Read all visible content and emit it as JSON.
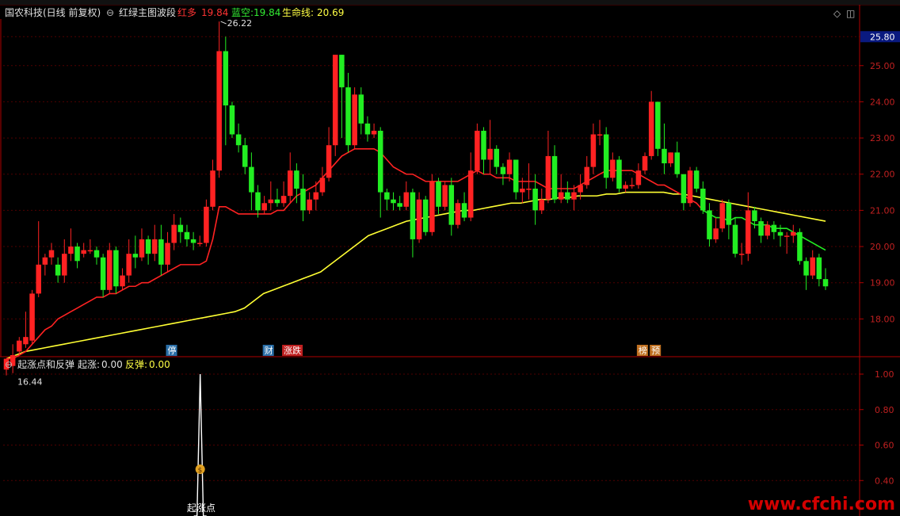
{
  "header": {
    "stock_name": "国农科技(日线 前复权)",
    "indicator_name": "红绿主图波段",
    "red_label": "红多",
    "red_value": "19.84",
    "blue_label": "蓝空:",
    "blue_value": "19.84",
    "life_label": "生命线:",
    "life_value": "20.69"
  },
  "sub_header": {
    "indicator_name": "起涨点和反弹",
    "rise_label": "起涨:",
    "rise_value": "0.00",
    "rebound_label": "反弹:",
    "rebound_value": "0.00"
  },
  "price_axis": {
    "current_price": "25.80",
    "ticks": [
      18,
      19,
      20,
      21,
      22,
      23,
      24,
      25
    ],
    "range": [
      17.0,
      26.2
    ]
  },
  "sub_axis": {
    "ticks": [
      "1.00",
      "0.80",
      "0.60",
      "0.40"
    ],
    "range": [
      0.2,
      1.0
    ]
  },
  "annotations": {
    "high_label": "26.22",
    "low_label": "16.44",
    "rise_point_label": "起涨点",
    "markers": [
      {
        "text": "停",
        "color": "#2a6fa8",
        "index": 25
      },
      {
        "text": "财",
        "color": "#2a6fa8",
        "index": 40
      },
      {
        "text": "涨跌",
        "color": "#c02020",
        "index": 43
      },
      {
        "text": "榜",
        "color": "#c07020",
        "index": 98
      },
      {
        "text": "预",
        "color": "#c07020",
        "index": 100
      }
    ]
  },
  "colors": {
    "up": "#ff2222",
    "down": "#22ee22",
    "red_line": "#ff2222",
    "green_line": "#22ee22",
    "life_line": "#ffff33",
    "axis": "#b00000",
    "grid": "#500000"
  },
  "chart_data": {
    "type": "candlestick",
    "candles": [
      [
        16.6,
        16.9,
        16.44,
        16.7
      ],
      [
        16.7,
        17.0,
        16.5,
        17.3
      ],
      [
        17.1,
        17.4,
        17.0,
        17.5
      ],
      [
        17.3,
        17.5,
        17.2,
        18.2
      ],
      [
        17.4,
        18.7,
        17.3,
        18.8
      ],
      [
        18.7,
        19.5,
        18.6,
        20.7
      ],
      [
        19.5,
        19.7,
        19.2,
        19.8
      ],
      [
        19.7,
        19.9,
        19.5,
        20.1
      ],
      [
        19.5,
        19.2,
        19.0,
        19.7
      ],
      [
        19.2,
        19.8,
        19.0,
        20.2
      ],
      [
        19.8,
        20.0,
        19.6,
        20.5
      ],
      [
        20.0,
        19.6,
        19.4,
        20.1
      ],
      [
        19.8,
        19.9,
        19.7,
        20.1
      ],
      [
        19.9,
        19.9,
        19.8,
        20.2
      ],
      [
        19.9,
        19.7,
        19.5,
        20.0
      ],
      [
        19.7,
        18.8,
        18.6,
        19.8
      ],
      [
        18.8,
        19.9,
        18.7,
        20.1
      ],
      [
        19.9,
        18.9,
        18.7,
        20.0
      ],
      [
        18.9,
        19.2,
        18.8,
        19.4
      ],
      [
        19.2,
        19.8,
        19.0,
        20.2
      ],
      [
        19.8,
        19.7,
        19.4,
        20.3
      ],
      [
        19.7,
        20.2,
        19.6,
        20.5
      ],
      [
        20.2,
        19.8,
        19.5,
        20.3
      ],
      [
        19.8,
        20.2,
        19.6,
        20.6
      ],
      [
        20.2,
        19.5,
        19.2,
        20.6
      ],
      [
        19.5,
        20.1,
        19.3,
        20.4
      ],
      [
        20.1,
        20.6,
        19.9,
        20.9
      ],
      [
        20.6,
        20.4,
        20.1,
        20.8
      ],
      [
        20.4,
        20.2,
        20.0,
        20.6
      ],
      [
        20.2,
        20.1,
        19.9,
        20.4
      ],
      [
        20.1,
        20.1,
        20.0,
        20.3
      ],
      [
        20.1,
        21.1,
        20.0,
        21.3
      ],
      [
        21.1,
        22.1,
        21.0,
        22.4
      ],
      [
        22.1,
        25.4,
        21.9,
        26.22
      ],
      [
        25.4,
        23.9,
        22.8,
        25.8
      ],
      [
        23.9,
        23.1,
        23.0,
        24.0
      ],
      [
        23.1,
        22.8,
        22.6,
        23.4
      ],
      [
        22.8,
        22.2,
        22.0,
        23.0
      ],
      [
        22.2,
        21.5,
        21.0,
        22.6
      ],
      [
        21.5,
        21.0,
        20.8,
        21.7
      ],
      [
        21.0,
        21.2,
        20.9,
        21.4
      ],
      [
        21.2,
        21.3,
        21.0,
        21.8
      ],
      [
        21.3,
        21.2,
        21.1,
        21.6
      ],
      [
        21.2,
        21.4,
        21.1,
        21.8
      ],
      [
        21.4,
        22.1,
        21.2,
        22.6
      ],
      [
        22.1,
        21.6,
        21.2,
        22.3
      ],
      [
        21.6,
        21.0,
        20.7,
        22.0
      ],
      [
        21.0,
        21.3,
        20.9,
        21.5
      ],
      [
        21.3,
        21.5,
        21.0,
        21.8
      ],
      [
        21.5,
        21.9,
        21.4,
        22.2
      ],
      [
        21.9,
        22.8,
        21.8,
        23.3
      ],
      [
        22.8,
        25.3,
        22.5,
        25.3
      ],
      [
        25.3,
        24.4,
        23.0,
        25.3
      ],
      [
        24.4,
        22.8,
        22.6,
        24.8
      ],
      [
        22.8,
        24.2,
        22.7,
        24.4
      ],
      [
        24.2,
        23.4,
        23.1,
        24.4
      ],
      [
        23.4,
        23.1,
        22.9,
        23.6
      ],
      [
        23.1,
        23.2,
        23.0,
        23.4
      ],
      [
        23.2,
        21.5,
        20.8,
        23.3
      ],
      [
        21.5,
        21.3,
        21.0,
        21.6
      ],
      [
        21.3,
        21.2,
        21.0,
        21.5
      ],
      [
        21.2,
        21.1,
        21.0,
        21.4
      ],
      [
        21.1,
        21.5,
        21.0,
        21.8
      ],
      [
        21.5,
        20.2,
        19.7,
        21.6
      ],
      [
        20.2,
        21.3,
        20.1,
        21.5
      ],
      [
        21.3,
        20.4,
        20.3,
        21.4
      ],
      [
        20.4,
        21.8,
        20.3,
        22.0
      ],
      [
        21.8,
        21.1,
        20.9,
        21.9
      ],
      [
        21.1,
        21.7,
        21.0,
        21.8
      ],
      [
        21.7,
        20.6,
        20.3,
        21.9
      ],
      [
        20.6,
        21.2,
        20.5,
        21.3
      ],
      [
        21.2,
        20.8,
        20.7,
        21.5
      ],
      [
        20.8,
        22.1,
        20.7,
        22.6
      ],
      [
        22.1,
        23.2,
        22.0,
        23.4
      ],
      [
        23.2,
        22.4,
        22.0,
        23.3
      ],
      [
        22.4,
        22.7,
        22.0,
        23.5
      ],
      [
        22.7,
        22.2,
        22.0,
        22.8
      ],
      [
        22.2,
        22.0,
        21.7,
        22.3
      ],
      [
        22.0,
        22.4,
        21.8,
        22.6
      ],
      [
        22.4,
        21.5,
        21.3,
        22.4
      ],
      [
        21.5,
        21.6,
        21.2,
        21.9
      ],
      [
        21.6,
        21.6,
        21.3,
        22.3
      ],
      [
        21.6,
        21.0,
        20.6,
        22.0
      ],
      [
        21.0,
        21.3,
        20.9,
        21.6
      ],
      [
        21.3,
        22.5,
        21.2,
        23.2
      ],
      [
        22.5,
        21.3,
        21.2,
        22.8
      ],
      [
        21.3,
        21.5,
        21.2,
        22.0
      ],
      [
        21.5,
        21.3,
        21.2,
        21.8
      ],
      [
        21.3,
        21.5,
        21.0,
        21.7
      ],
      [
        21.5,
        21.7,
        21.3,
        22.0
      ],
      [
        21.7,
        22.2,
        21.6,
        22.5
      ],
      [
        22.2,
        23.1,
        22.0,
        23.4
      ],
      [
        23.1,
        23.1,
        22.8,
        23.5
      ],
      [
        23.1,
        21.9,
        21.6,
        23.3
      ],
      [
        21.9,
        22.4,
        21.8,
        22.6
      ],
      [
        22.4,
        21.6,
        21.5,
        22.5
      ],
      [
        21.6,
        21.7,
        21.5,
        21.8
      ],
      [
        21.7,
        21.7,
        21.6,
        21.9
      ],
      [
        21.7,
        22.1,
        21.6,
        22.3
      ],
      [
        22.1,
        22.5,
        22.0,
        22.6
      ],
      [
        22.5,
        24.0,
        22.4,
        24.3
      ],
      [
        24.0,
        22.7,
        22.5,
        24.0
      ],
      [
        22.7,
        22.3,
        22.0,
        23.4
      ],
      [
        22.3,
        22.6,
        22.2,
        22.6
      ],
      [
        22.6,
        22.0,
        21.9,
        22.9
      ],
      [
        22.0,
        21.2,
        21.0,
        22.0
      ],
      [
        21.2,
        22.1,
        21.1,
        22.2
      ],
      [
        22.1,
        21.6,
        21.5,
        22.2
      ],
      [
        21.6,
        21.0,
        20.9,
        21.8
      ],
      [
        21.0,
        20.2,
        20.0,
        21.2
      ],
      [
        20.2,
        20.5,
        20.1,
        20.8
      ],
      [
        20.5,
        21.2,
        20.4,
        21.3
      ],
      [
        21.2,
        20.6,
        20.2,
        21.3
      ],
      [
        20.6,
        19.8,
        19.7,
        20.8
      ],
      [
        19.8,
        19.8,
        19.5,
        20.1
      ],
      [
        19.8,
        21.0,
        19.6,
        21.5
      ],
      [
        21.0,
        20.7,
        20.5,
        21.1
      ],
      [
        20.7,
        20.3,
        20.1,
        20.8
      ],
      [
        20.3,
        20.6,
        20.2,
        20.7
      ],
      [
        20.6,
        20.4,
        20.2,
        20.7
      ],
      [
        20.4,
        20.3,
        20.0,
        20.6
      ],
      [
        20.3,
        20.3,
        19.8,
        20.4
      ],
      [
        20.3,
        20.4,
        20.1,
        20.6
      ],
      [
        20.4,
        19.6,
        19.5,
        20.5
      ],
      [
        19.6,
        19.2,
        18.8,
        19.7
      ],
      [
        19.2,
        19.7,
        19.1,
        19.9
      ],
      [
        19.7,
        19.1,
        18.9,
        19.8
      ],
      [
        19.1,
        18.9,
        18.8,
        19.4
      ]
    ],
    "red_line": [
      16.9,
      16.9,
      17.0,
      17.1,
      17.3,
      17.5,
      17.7,
      17.8,
      18.0,
      18.1,
      18.2,
      18.3,
      18.4,
      18.5,
      18.6,
      18.6,
      18.7,
      18.7,
      18.8,
      18.9,
      18.9,
      19.0,
      19.0,
      19.1,
      19.2,
      19.3,
      19.4,
      19.5,
      19.5,
      19.5,
      19.5,
      19.6,
      20.2,
      21.1,
      21.1,
      21.0,
      20.9,
      20.9,
      20.9,
      20.9,
      20.9,
      20.9,
      21.0,
      21.0,
      21.2,
      21.4,
      21.5,
      21.6,
      21.7,
      21.9,
      22.1,
      22.3,
      22.5,
      22.6,
      22.7,
      22.7,
      22.7,
      22.7,
      22.6,
      22.4,
      22.2,
      22.1,
      22.0,
      22.0,
      21.9,
      21.8,
      21.8,
      21.8,
      21.8,
      21.8,
      21.8,
      21.9,
      22.0,
      22.1,
      22.0,
      22.0,
      21.9,
      21.9,
      21.9,
      21.8,
      21.8,
      21.8,
      21.8,
      21.7,
      21.6,
      21.6,
      21.6,
      21.6,
      21.6,
      21.7,
      21.8,
      21.9,
      22.0,
      22.1,
      22.1,
      22.1,
      22.1,
      22.1,
      22.0,
      21.9,
      21.8,
      21.7,
      21.7,
      21.6,
      21.5,
      21.4,
      21.3,
      21.2,
      21.0
    ],
    "green_line": [
      21.0,
      20.9,
      20.8,
      20.8,
      20.7,
      20.8,
      20.8,
      20.7,
      20.6,
      20.6,
      20.6,
      20.5,
      20.5,
      20.5,
      20.4,
      20.3,
      20.2,
      20.1,
      20.0,
      19.9
    ],
    "life_line": [
      16.9,
      17.0,
      17.1,
      17.15,
      17.2,
      17.25,
      17.3,
      17.35,
      17.4,
      17.45,
      17.5,
      17.55,
      17.6,
      17.65,
      17.7,
      17.75,
      17.8,
      17.85,
      17.9,
      17.95,
      18.0,
      18.05,
      18.1,
      18.15,
      18.2,
      18.3,
      18.5,
      18.7,
      18.8,
      18.9,
      19.0,
      19.1,
      19.2,
      19.3,
      19.5,
      19.7,
      19.9,
      20.1,
      20.3,
      20.4,
      20.5,
      20.6,
      20.7,
      20.75,
      20.8,
      20.85,
      20.9,
      20.95,
      21.0,
      21.0,
      21.05,
      21.1,
      21.15,
      21.2,
      21.2,
      21.25,
      21.3,
      21.3,
      21.35,
      21.35,
      21.4,
      21.4,
      21.4,
      21.45,
      21.45,
      21.5,
      21.5,
      21.5,
      21.5,
      21.5,
      21.45,
      21.45,
      21.4,
      21.35,
      21.3,
      21.25,
      21.2,
      21.15,
      21.1,
      21.05,
      21.0,
      20.95,
      20.9,
      20.85,
      20.8,
      20.75,
      20.7
    ],
    "sub_line": [
      0.2,
      0.2,
      1.0,
      0.2,
      0.2
    ]
  }
}
